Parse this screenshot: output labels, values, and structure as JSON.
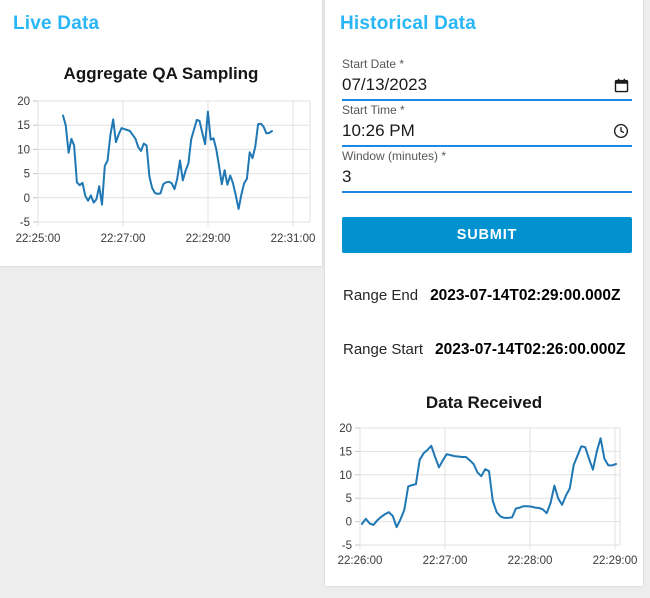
{
  "colors": {
    "accent_heading": "#29b6f6",
    "button_primary": "#0292cf",
    "input_underline": "#1e88e5",
    "chart_line": "#1f77b4",
    "page_background": "#ededed",
    "card_background": "#ffffff"
  },
  "live_panel": {
    "title": "Live Data"
  },
  "historical_panel": {
    "title": "Historical Data",
    "fields": {
      "start_date": {
        "label": "Start Date *",
        "value": "07/13/2023",
        "icon": "calendar-icon"
      },
      "start_time": {
        "label": "Start Time *",
        "value": "10:26 PM",
        "icon": "clock-icon"
      },
      "window_minutes": {
        "label": "Window (minutes) *",
        "value": "3"
      }
    },
    "submit_label": "SUBMIT",
    "range_end": {
      "label": "Range End",
      "value": "2023-07-14T02:29:00.000Z"
    },
    "range_start": {
      "label": "Range Start",
      "value": "2023-07-14T02:26:00.000Z"
    }
  },
  "chart_data": [
    {
      "id": "live",
      "type": "line",
      "title": "Aggregate QA Sampling",
      "xlabel": "",
      "ylabel": "",
      "grid": true,
      "legend": false,
      "x_axis": {
        "ticks": [
          "22:25:00",
          "22:27:00",
          "22:29:00",
          "22:31:00"
        ],
        "data_start": "22:25:35",
        "data_end": "22:30:30"
      },
      "y_axis": {
        "min": -5,
        "max": 20,
        "ticks": [
          20,
          15,
          10,
          5,
          0,
          -5
        ]
      },
      "series": [
        {
          "name": "Aggregate QA Sampling",
          "color": "#1f77b4",
          "values": [
            17.0,
            14.9,
            9.3,
            12.2,
            10.8,
            3.2,
            2.6,
            3.1,
            0.4,
            -0.6,
            0.5,
            -1.0,
            -0.3,
            2.4,
            -1.4,
            6.6,
            7.7,
            13.0,
            16.2,
            11.5,
            13.1,
            14.4,
            14.2,
            14.0,
            13.8,
            13.0,
            12.2,
            10.5,
            9.7,
            11.2,
            10.8,
            4.4,
            2.0,
            1.0,
            0.8,
            0.9,
            2.8,
            3.2,
            3.3,
            3.0,
            1.8,
            4.0,
            7.7,
            3.6,
            5.6,
            7.1,
            12.1,
            14.1,
            16.1,
            15.9,
            13.4,
            11.1,
            17.8,
            12.0,
            12.3,
            10.0,
            6.5,
            2.8,
            5.7,
            2.7,
            4.6,
            3.0,
            0.5,
            -2.3,
            0.6,
            3.0,
            3.9,
            9.4,
            8.2,
            10.6,
            15.2,
            15.3,
            14.7,
            13.3,
            13.4,
            13.8
          ]
        }
      ]
    },
    {
      "id": "received",
      "type": "line",
      "title": "Data Received",
      "xlabel": "",
      "ylabel": "",
      "grid": true,
      "legend": false,
      "x_axis": {
        "ticks": [
          "22:26:00",
          "22:27:00",
          "22:28:00",
          "22:29:00"
        ],
        "data_start": "22:26:05",
        "data_end": "22:29:00"
      },
      "y_axis": {
        "min": -5,
        "max": 20,
        "ticks": [
          20,
          15,
          10,
          5,
          0,
          -5
        ]
      },
      "series": [
        {
          "name": "Data Received",
          "color": "#1f77b4",
          "values": [
            -0.5,
            0.6,
            -0.4,
            -0.7,
            0.3,
            1.0,
            1.6,
            2.0,
            1.2,
            -1.2,
            0.5,
            2.5,
            7.5,
            7.8,
            8.0,
            13.2,
            14.6,
            15.3,
            16.2,
            13.8,
            11.6,
            13.1,
            14.4,
            14.2,
            14.0,
            13.9,
            13.8,
            13.8,
            13.1,
            12.3,
            10.5,
            9.7,
            11.2,
            10.8,
            4.4,
            2.0,
            1.1,
            0.8,
            0.8,
            0.9,
            2.8,
            3.0,
            3.3,
            3.3,
            3.2,
            3.0,
            2.9,
            2.6,
            1.8,
            4.0,
            7.7,
            4.9,
            3.6,
            5.6,
            7.1,
            12.1,
            14.1,
            16.1,
            15.9,
            13.4,
            11.1,
            15.0,
            17.8,
            13.4,
            12.0,
            12.0,
            12.3
          ]
        }
      ]
    }
  ]
}
